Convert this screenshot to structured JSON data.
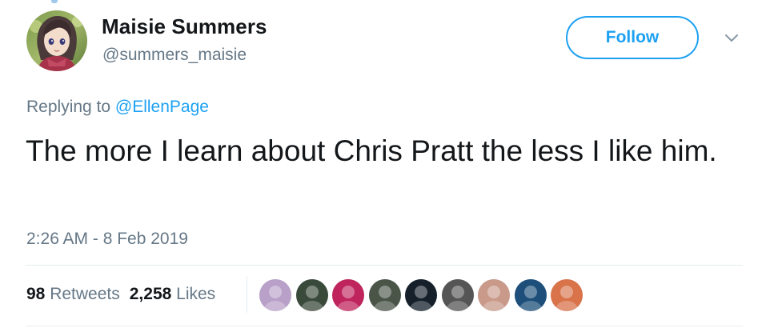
{
  "header": {
    "display_name": "Maisie Summers",
    "handle": "@summers_maisie",
    "follow_label": "Follow",
    "avatar_icon": "user-avatar-illustrated",
    "menu_icon": "chevron-down-icon"
  },
  "reply": {
    "prefix": "Replying to",
    "mention": "@EllenPage"
  },
  "tweet": {
    "text": "The more I learn about Chris Pratt the less I like him.",
    "timestamp": "2:26 AM - 8 Feb 2019"
  },
  "stats": {
    "retweets_count": "98",
    "retweets_label": "Retweets",
    "likes_count": "2,258",
    "likes_label": "Likes"
  },
  "likers": [
    {
      "name": "liker-avatar-1",
      "color": "#b8a0c8"
    },
    {
      "name": "liker-avatar-2",
      "color": "#3a4a3a"
    },
    {
      "name": "liker-avatar-3",
      "color": "#c0245c"
    },
    {
      "name": "liker-avatar-4",
      "color": "#4a5548"
    },
    {
      "name": "liker-avatar-5",
      "color": "#15202b"
    },
    {
      "name": "liker-avatar-6",
      "color": "#555555"
    },
    {
      "name": "liker-avatar-7",
      "color": "#c99a8a"
    },
    {
      "name": "liker-avatar-8",
      "color": "#1d4f7a"
    },
    {
      "name": "liker-avatar-9",
      "color": "#d8734a"
    }
  ],
  "colors": {
    "accent": "#1da1f2",
    "secondary_text": "#657786",
    "primary_text": "#14171a",
    "divider": "#e6ecf0"
  }
}
